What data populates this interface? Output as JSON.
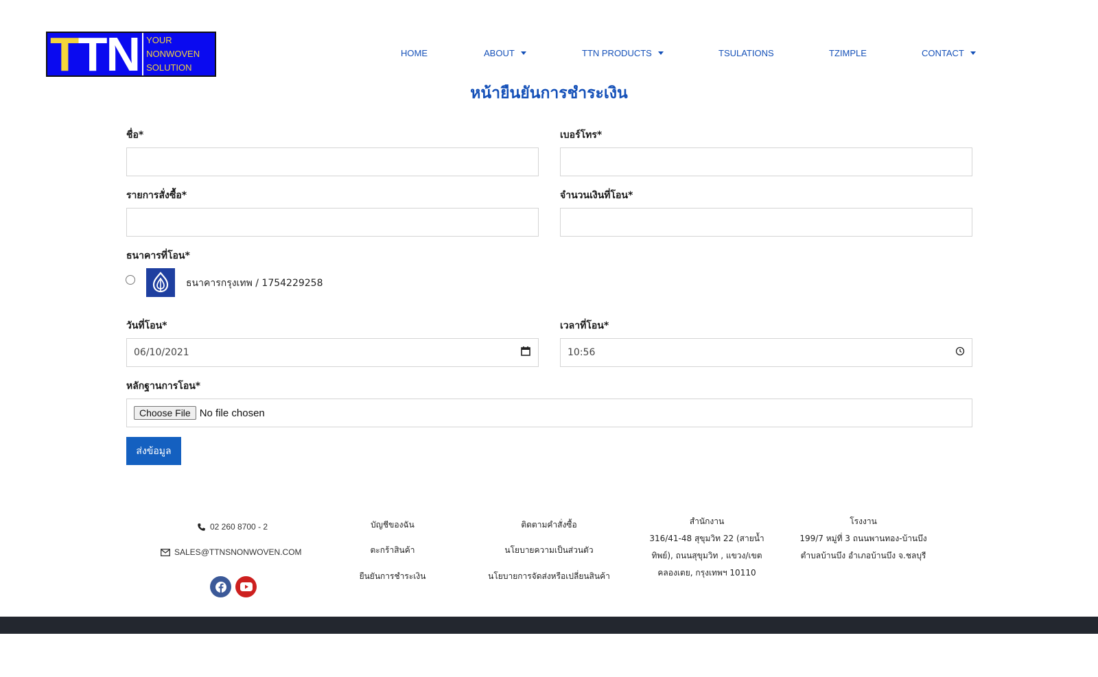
{
  "logo": {
    "mark_part1": "T",
    "mark_part2": "TN",
    "tagline": [
      "YOUR",
      "NONWOVEN",
      "SOLUTION"
    ]
  },
  "nav": {
    "items": [
      {
        "label": "HOME",
        "dropdown": false
      },
      {
        "label": "ABOUT",
        "dropdown": true
      },
      {
        "label": "TTN PRODUCTS",
        "dropdown": true
      },
      {
        "label": "TSULATIONS",
        "dropdown": false
      },
      {
        "label": "TZIMPLE",
        "dropdown": false
      },
      {
        "label": "CONTACT",
        "dropdown": true
      }
    ]
  },
  "form": {
    "title": "หน้ายืนยันการชำระเงิน",
    "name_label": "ชื่อ*",
    "name_value": "",
    "phone_label": "เบอร์โทร*",
    "phone_value": "",
    "order_label": "รายการสั่งซื้อ*",
    "order_value": "",
    "amount_label": "จำนวนเงินที่โอน*",
    "amount_value": "",
    "bank_label": "ธนาคารที่โอน*",
    "bank_option": "ธนาคารกรุงเทพ / 1754229258",
    "bank_selected": false,
    "date_label": "วันที่โอน*",
    "date_value": "06/10/2021",
    "time_label": "เวลาที่โอน*",
    "time_value": "10:56",
    "proof_label": "หลักฐานการโอน*",
    "file_button": "Choose File",
    "file_status": "No file chosen",
    "submit_label": "ส่งข้อมูล"
  },
  "footer": {
    "phone": "02 260 8700 - 2",
    "email": "SALES@TTNSNONWOVEN.COM",
    "social": [
      "facebook",
      "youtube"
    ],
    "links_col1": [
      "บัญชีของฉัน",
      "ตะกร้าสินค้า",
      "ยืนยันการชำระเงิน"
    ],
    "links_col2": [
      "ติดตามคำสั่งซื้อ",
      "นโยบายความเป็นส่วนตัว",
      "นโยบายการจัดส่งหรือเปลี่ยนสินค้า"
    ],
    "office_title": "สำนักงาน",
    "office_lines": [
      "316/41-48 สุขุมวิท 22 (สายน้ำ",
      "ทิพย์), ถนนสุขุมวิท , แขวง/เขต",
      "คลองเตย, กรุงเทพฯ 10110"
    ],
    "factory_title": "โรงงาน",
    "factory_lines": [
      "199/7 หมู่ที่ 3 ถนนพานทอง-บ้านบึง",
      "ตำบลบ้านบึง อำเภอบ้านบึง จ.ชลบุรี"
    ]
  },
  "colors": {
    "brand_blue": "#1450b8",
    "logo_bg": "#0a0af0",
    "logo_yellow": "#f4d53a",
    "button_blue": "#1460c0",
    "bank_blue": "#1e3fa0",
    "facebook": "#3b5998",
    "youtube": "#cd201f",
    "footer_bar": "#23272f"
  }
}
